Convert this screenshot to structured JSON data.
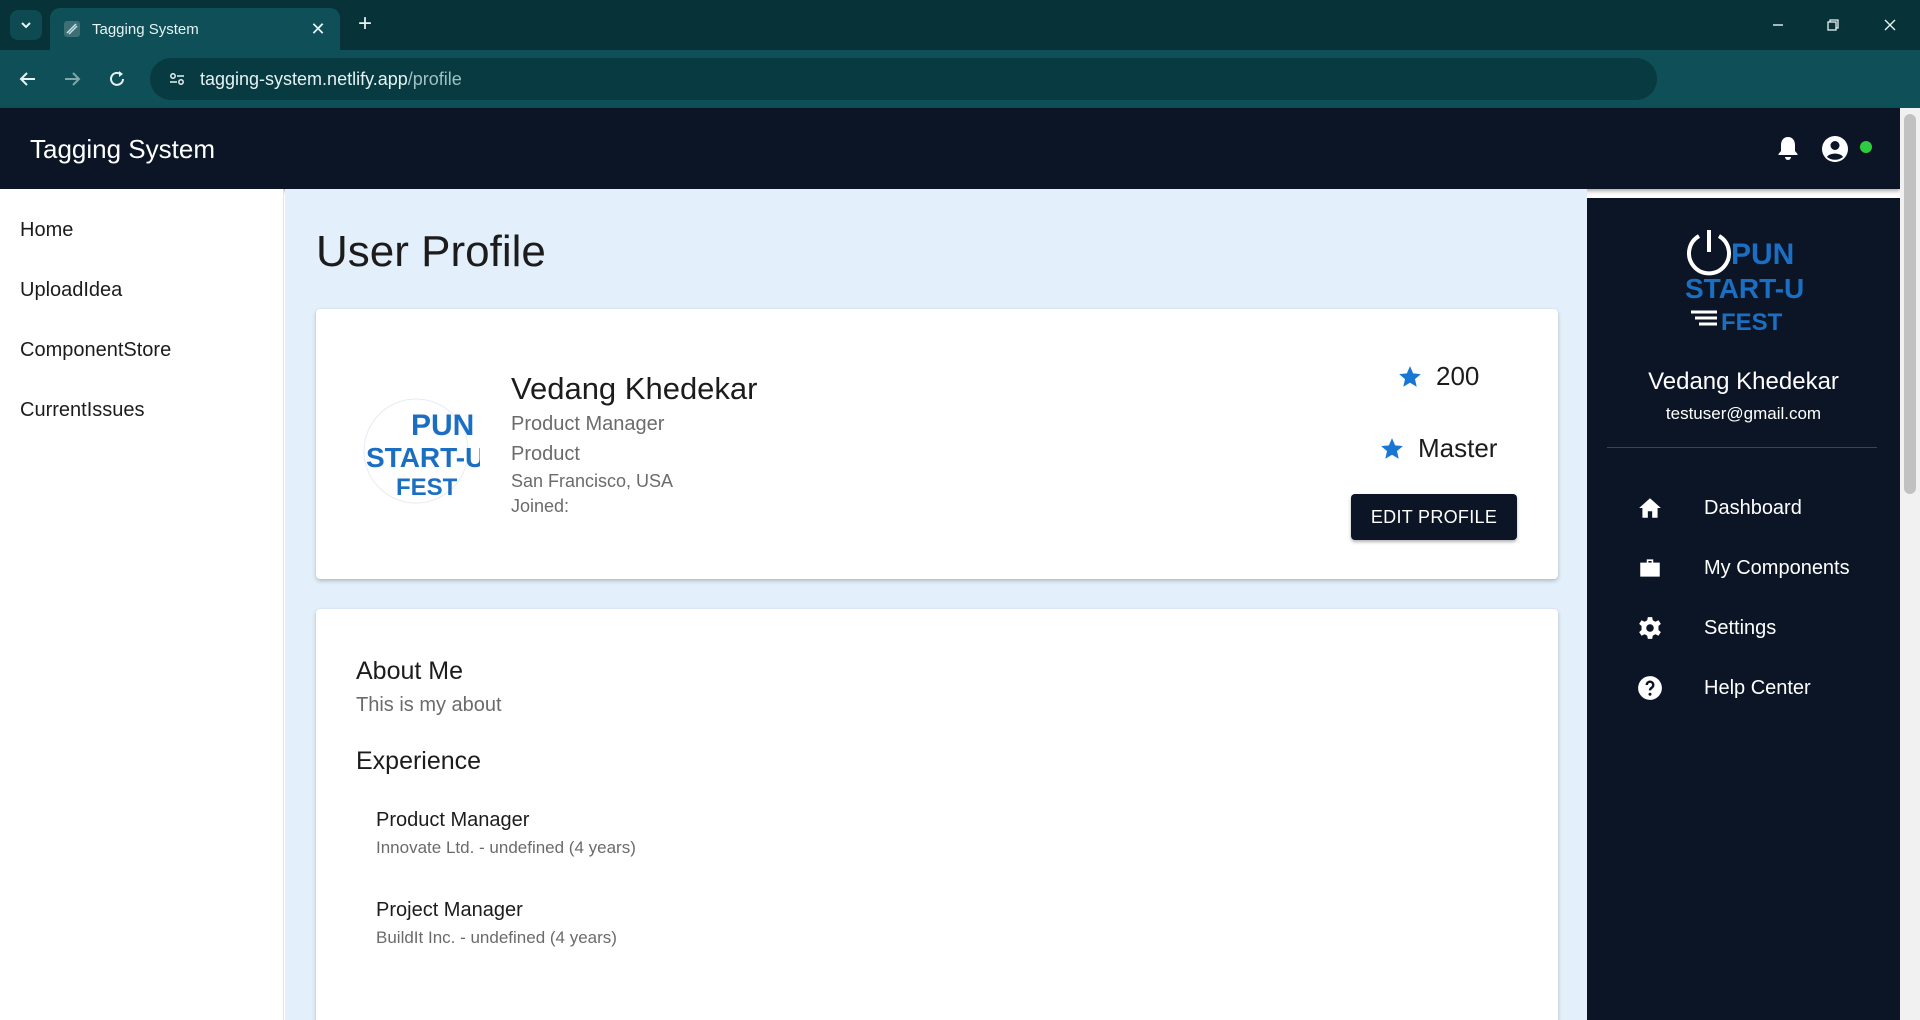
{
  "browser": {
    "tab_title": "Tagging System",
    "url_host": "tagging-system.netlify.app",
    "url_path": "/profile"
  },
  "app": {
    "title": "Tagging System"
  },
  "leftnav": {
    "items": [
      {
        "label": "Home"
      },
      {
        "label": "UploadIdea"
      },
      {
        "label": "ComponentStore"
      },
      {
        "label": "CurrentIssues"
      }
    ]
  },
  "main": {
    "page_title": "User Profile",
    "logo_text": [
      "PUN",
      "START-U",
      "FEST"
    ],
    "profile": {
      "name": "Vedang Khedekar",
      "role": "Product Manager",
      "department": "Product",
      "location": "San Francisco, USA",
      "joined": "Joined:",
      "points": "200",
      "level": "Master",
      "edit_label": "EDIT PROFILE"
    },
    "about": {
      "title": "About Me",
      "text": "This is my about"
    },
    "experience": {
      "title": "Experience",
      "items": [
        {
          "role": "Product Manager",
          "detail": "Innovate Ltd. - undefined (4 years)"
        },
        {
          "role": "Project Manager",
          "detail": "BuildIt Inc. - undefined (4 years)"
        }
      ]
    }
  },
  "rightpanel": {
    "name": "Vedang Khedekar",
    "email": "testuser@gmail.com",
    "menu": [
      {
        "label": "Dashboard",
        "icon": "home-icon"
      },
      {
        "label": "My Components",
        "icon": "briefcase-icon"
      },
      {
        "label": "Settings",
        "icon": "gear-icon"
      },
      {
        "label": "Help Center",
        "icon": "help-icon"
      }
    ]
  },
  "colors": {
    "appbar": "#0c1526",
    "main_bg": "#e3f0fb",
    "accent_star": "#1976d2",
    "online": "#2ecc40",
    "browser_frame": "#0f4f57"
  }
}
